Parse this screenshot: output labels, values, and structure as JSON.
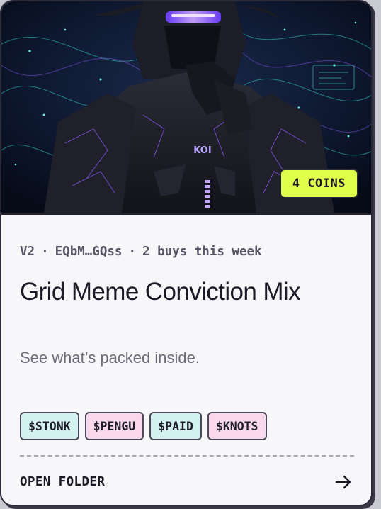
{
  "hero": {
    "image_description_icon": "samurai-cyber-art",
    "emblem_text": "KOI",
    "coins_badge": "4 COINS",
    "badge_color": "#e0ff4a"
  },
  "meta": {
    "version": "V2",
    "address": "EQbM…GQss",
    "buys": "2 buys this week",
    "separator": "·"
  },
  "title": "Grid Meme Conviction Mix",
  "subtitle": "See what’s packed inside.",
  "chips": [
    {
      "label": "$STONK",
      "color": "#d3f1ee"
    },
    {
      "label": "$PENGU",
      "color": "#f8d8ea"
    },
    {
      "label": "$PAID",
      "color": "#d3f1ee"
    },
    {
      "label": "$KNOTS",
      "color": "#f8d8ea"
    }
  ],
  "footer": {
    "label": "OPEN FOLDER",
    "icon": "arrow-right-icon"
  }
}
